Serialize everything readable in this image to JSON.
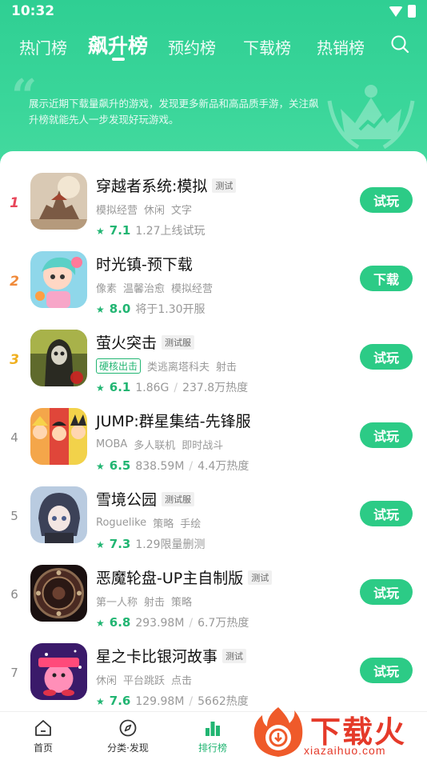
{
  "status_bar": {
    "time": "10:32"
  },
  "tabs": [
    {
      "label": "热门榜"
    },
    {
      "label": "飙升榜"
    },
    {
      "label": "预约榜"
    },
    {
      "label": "下载榜"
    },
    {
      "label": "热销榜"
    }
  ],
  "banner": {
    "description": "展示近期下载量飙升的游戏，发现更多新品和高品质手游，关注飙升榜就能先人一步发现好玩游戏。"
  },
  "apps": [
    {
      "rank": "1",
      "name": "穿越者系统:模拟",
      "tag": "测试",
      "cats": [
        "模拟经营",
        "休闲",
        "文字"
      ],
      "badge": "",
      "score": "7.1",
      "meta1": "1.27上线试玩",
      "meta2": "",
      "button": "试玩"
    },
    {
      "rank": "2",
      "name": "时光镇-预下载",
      "tag": "",
      "cats": [
        "像素",
        "温馨治愈",
        "模拟经营"
      ],
      "badge": "",
      "score": "8.0",
      "meta1": "将于1.30开服",
      "meta2": "",
      "button": "下载"
    },
    {
      "rank": "3",
      "name": "萤火突击",
      "tag": "测试服",
      "cats": [
        "类逃离塔科夫",
        "射击"
      ],
      "badge": "硬核出击",
      "score": "6.1",
      "meta1": "1.86G",
      "meta2": "237.8万热度",
      "button": "试玩"
    },
    {
      "rank": "4",
      "name": "JUMP:群星集结-先锋服",
      "tag": "",
      "cats": [
        "MOBA",
        "多人联机",
        "即时战斗"
      ],
      "badge": "",
      "score": "6.5",
      "meta1": "838.59M",
      "meta2": "4.4万热度",
      "button": "试玩"
    },
    {
      "rank": "5",
      "name": "雪境公园",
      "tag": "测试服",
      "cats": [
        "Roguelike",
        "策略",
        "手绘"
      ],
      "badge": "",
      "score": "7.3",
      "meta1": "1.29限量删测",
      "meta2": "",
      "button": "试玩"
    },
    {
      "rank": "6",
      "name": "恶魔轮盘-UP主自制版",
      "tag": "测试",
      "cats": [
        "第一人称",
        "射击",
        "策略"
      ],
      "badge": "",
      "score": "6.8",
      "meta1": "293.98M",
      "meta2": "6.7万热度",
      "button": "试玩"
    },
    {
      "rank": "7",
      "name": "星之卡比银河故事",
      "tag": "测试",
      "cats": [
        "休闲",
        "平台跳跃",
        "点击"
      ],
      "badge": "",
      "score": "7.6",
      "meta1": "129.98M",
      "meta2": "5662热度",
      "button": "试玩"
    }
  ],
  "bottom_nav": [
    {
      "label": "首页",
      "icon": "home-icon"
    },
    {
      "label": "分类·发现",
      "icon": "compass-icon"
    },
    {
      "label": "排行榜",
      "icon": "ranking-icon"
    }
  ],
  "watermark": {
    "title": "下载火",
    "url": "xiazaihuo.com"
  },
  "colors": {
    "accent": "#2ccb86",
    "header": "#34d297",
    "rank1": "#e8465a",
    "rank2": "#f08a3a",
    "rank3": "#f0b020"
  }
}
